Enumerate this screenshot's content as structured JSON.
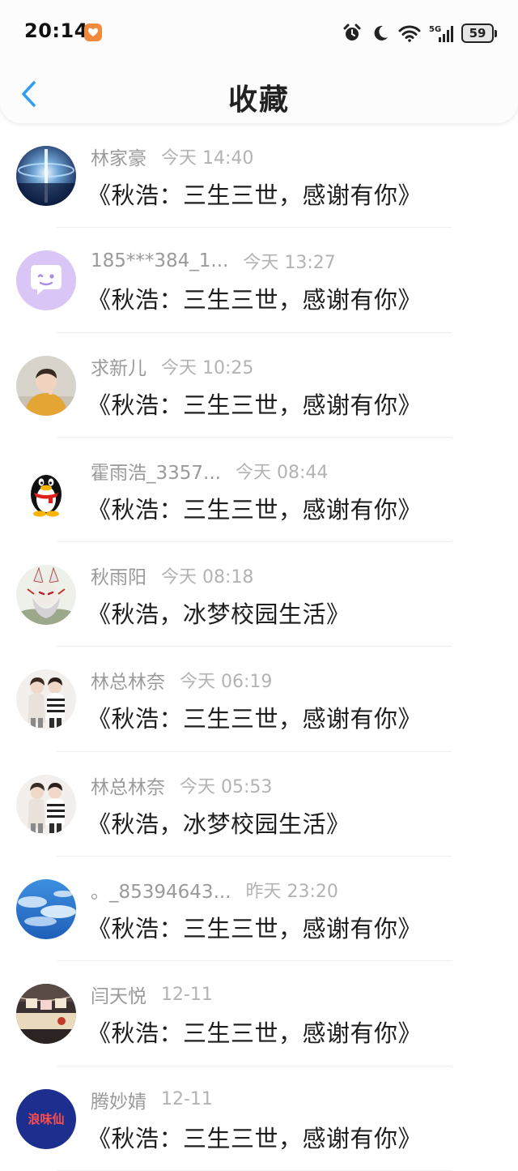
{
  "status_bar": {
    "time": "20:14",
    "battery": "59",
    "network": "5G"
  },
  "header": {
    "title": "收藏"
  },
  "colors": {
    "accent": "#2f9cf0",
    "name_gray": "#9a9a9a",
    "time_gray": "#b3b3b3",
    "title_text": "#1e1e1e"
  },
  "favorites": [
    {
      "name": "林家豪",
      "time": "今天 14:40",
      "title": "《秋浩：三生三世，感谢有你》",
      "avatar_icon": "light-beam-avatar"
    },
    {
      "name": "185***384_1...",
      "time": "今天 13:27",
      "title": "《秋浩：三生三世，感谢有你》",
      "avatar_icon": "chat-bubble-avatar"
    },
    {
      "name": "求新儿",
      "time": "今天 10:25",
      "title": "《秋浩：三生三世，感谢有你》",
      "avatar_icon": "person-photo-avatar"
    },
    {
      "name": "霍雨浩_3357...",
      "time": "今天 08:44",
      "title": "《秋浩：三生三世，感谢有你》",
      "avatar_icon": "qq-penguin-avatar"
    },
    {
      "name": "秋雨阳",
      "time": "今天 08:18",
      "title": "《秋浩，冰梦校园生活》",
      "avatar_icon": "anime-character-avatar"
    },
    {
      "name": "林总林奈",
      "time": "今天 06:19",
      "title": "《秋浩：三生三世，感谢有你》",
      "avatar_icon": "two-girls-photo-avatar"
    },
    {
      "name": "林总林奈",
      "time": "今天 05:53",
      "title": "《秋浩，冰梦校园生活》",
      "avatar_icon": "two-girls-photo-avatar"
    },
    {
      "name": "。_85394643...",
      "time": "昨天 23:20",
      "title": "《秋浩：三生三世，感谢有你》",
      "avatar_icon": "blue-sky-avatar"
    },
    {
      "name": "闫天悦",
      "time": "12-11",
      "title": "《秋浩：三生三世，感谢有你》",
      "avatar_icon": "love-photo-avatar"
    },
    {
      "name": "腾妙婧",
      "time": "12-11",
      "title": "《秋浩：三生三世，感谢有你》",
      "avatar_icon": "text-logo-avatar",
      "avatar_text": "浪味仙"
    }
  ]
}
